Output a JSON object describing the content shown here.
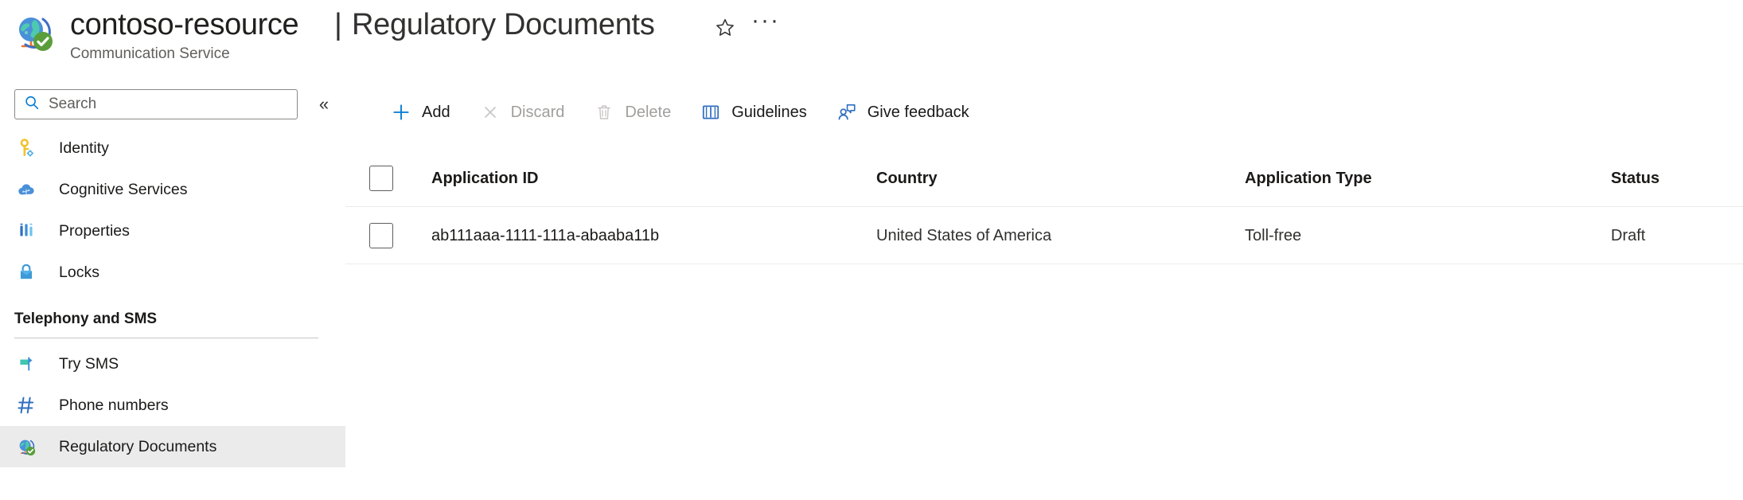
{
  "header": {
    "resource_icon": "globe-check-icon",
    "resource_name": "contoso-resource",
    "resource_type": "Communication Service",
    "separator": "|",
    "page_title": "Regulatory Documents",
    "favorite_icon": "star-icon",
    "more_icon": "ellipsis-icon",
    "more_label": "···"
  },
  "sidebar": {
    "search": {
      "icon": "search-icon",
      "value": "",
      "placeholder": "Search"
    },
    "collapse": {
      "icon": "chevron-double-left-icon",
      "label": "«"
    },
    "items": [
      {
        "label": "Identity",
        "icon": "key-identity-icon",
        "selected": false
      },
      {
        "label": "Cognitive Services",
        "icon": "cloud-brain-icon",
        "selected": false
      },
      {
        "label": "Properties",
        "icon": "properties-bars-icon",
        "selected": false
      },
      {
        "label": "Locks",
        "icon": "lock-icon",
        "selected": false
      }
    ],
    "group": {
      "title": "Telephony and SMS",
      "items": [
        {
          "label": "Try SMS",
          "icon": "flag-sms-icon",
          "selected": false
        },
        {
          "label": "Phone numbers",
          "icon": "hash-number-icon",
          "selected": false
        },
        {
          "label": "Regulatory Documents",
          "icon": "globe-check-icon",
          "selected": true
        }
      ]
    }
  },
  "toolbar": {
    "commands": [
      {
        "label": "Add",
        "icon": "plus-icon",
        "disabled": false
      },
      {
        "label": "Discard",
        "icon": "close-x-icon",
        "disabled": true
      },
      {
        "label": "Delete",
        "icon": "trash-icon",
        "disabled": true
      },
      {
        "label": "Guidelines",
        "icon": "book-icon",
        "disabled": false
      },
      {
        "label": "Give feedback",
        "icon": "person-feedback-icon",
        "disabled": false
      }
    ]
  },
  "table": {
    "select_all_checkbox": {
      "icon": "checkbox-icon",
      "checked": false
    },
    "columns": [
      "Application ID",
      "Country",
      "Application Type",
      "Status"
    ],
    "rows": [
      {
        "checkbox": {
          "icon": "checkbox-icon",
          "checked": false
        },
        "application_id": "ab111aaa-1111-111a-abaaba11b",
        "country": "United States of America",
        "application_type": "Toll-free",
        "status": "Draft"
      }
    ]
  },
  "colors": {
    "accent": "#0078d4",
    "selected_nav_bg": "#ebebeb",
    "border": "#edebe9",
    "disabled_text": "#a19f9d",
    "subtitle_text": "#605e5c"
  }
}
